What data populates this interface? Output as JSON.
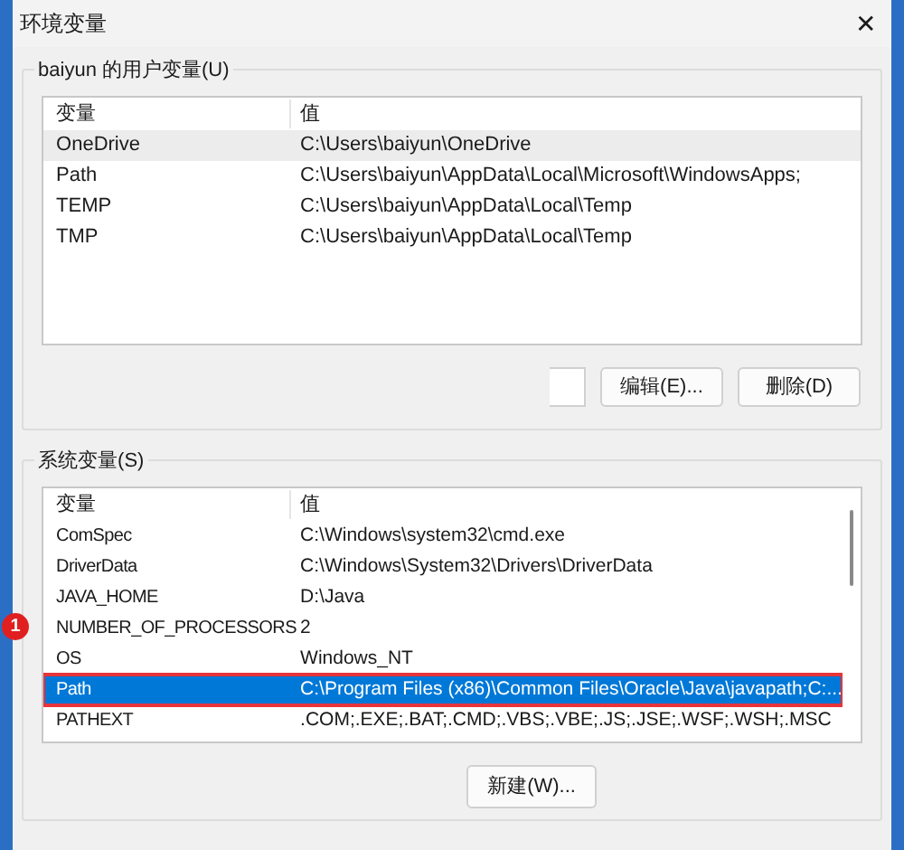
{
  "window": {
    "title": "环境变量",
    "close": "✕"
  },
  "user_variables": {
    "title": "baiyun 的用户变量(U)",
    "columns": [
      "变量",
      "值"
    ],
    "rows": [
      {
        "name": "OneDrive",
        "value": "C:\\Users\\baiyun\\OneDrive",
        "selected": false,
        "hovered": true
      },
      {
        "name": "Path",
        "value": "C:\\Users\\baiyun\\AppData\\Local\\Microsoft\\WindowsApps;",
        "selected": false,
        "hovered": false
      },
      {
        "name": "TEMP",
        "value": "C:\\Users\\baiyun\\AppData\\Local\\Temp",
        "selected": false,
        "hovered": false
      },
      {
        "name": "TMP",
        "value": "C:\\Users\\baiyun\\AppData\\Local\\Temp",
        "selected": false,
        "hovered": false
      }
    ],
    "buttons": [
      "编辑(E)...",
      "删除(D)"
    ]
  },
  "system_variables": {
    "title": "系统变量(S)",
    "columns": [
      "变量",
      "值"
    ],
    "rows": [
      {
        "name": "ComSpec",
        "value": "C:\\Windows\\system32\\cmd.exe",
        "selected": false,
        "highlighted": false
      },
      {
        "name": "DriverData",
        "value": "C:\\Windows\\System32\\Drivers\\DriverData",
        "selected": false,
        "highlighted": false
      },
      {
        "name": "JAVA_HOME",
        "value": "D:\\Java",
        "selected": false,
        "highlighted": false
      },
      {
        "name": "NUMBER_OF_PROCESSORS",
        "value": "2",
        "selected": false,
        "highlighted": false
      },
      {
        "name": "OS",
        "value": "Windows_NT",
        "selected": false,
        "highlighted": false
      },
      {
        "name": "Path",
        "value": "C:\\Program Files (x86)\\Common Files\\Oracle\\Java\\javapath;C:...",
        "selected": true,
        "highlighted": true
      },
      {
        "name": "PATHEXT",
        "value": ".COM;.EXE;.BAT;.CMD;.VBS;.VBE;.JS;.JSE;.WSF;.WSH;.MSC",
        "selected": false,
        "highlighted": false
      }
    ],
    "buttons": [
      "新建(W)..."
    ]
  },
  "annotation": {
    "number": "1"
  }
}
